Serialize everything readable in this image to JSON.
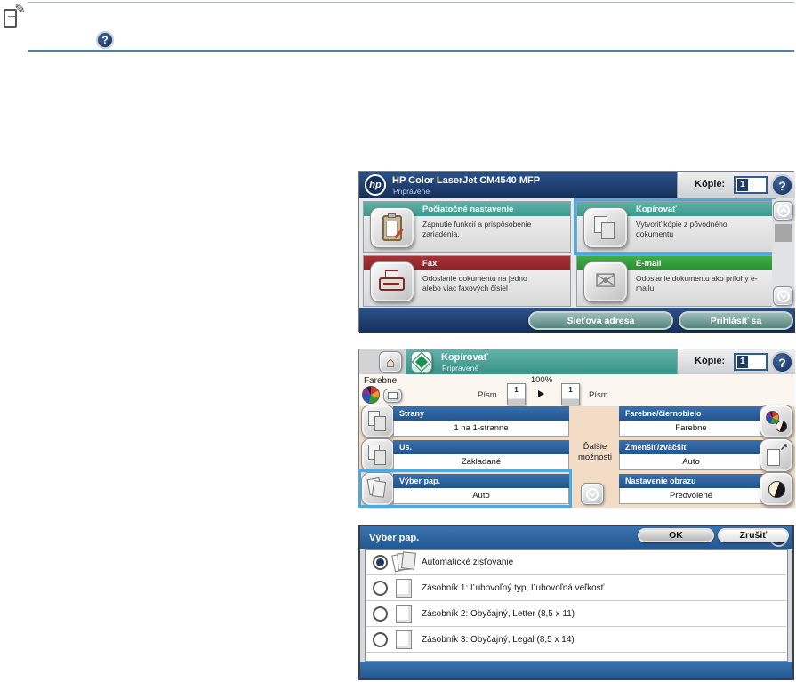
{
  "glyphs": {
    "question": "?",
    "note_pencil": "✎",
    "home": "⌂",
    "envelope": "✉",
    "scale_arrow": "↗"
  },
  "home_screen": {
    "logo_text": "hp",
    "title": "HP Color LaserJet CM4540 MFP",
    "status": "Pripravené",
    "copies_label": "Kópie:",
    "copies_value": "1",
    "tiles": [
      {
        "label": "Počiatočné nastavenie",
        "desc": "Zapnutie funkcií a prispôsobenie\nzariadenia."
      },
      {
        "label": "Kopírovať",
        "desc": "Vytvoriť kópie z pôvodného\ndokumentu"
      },
      {
        "label": "Fax",
        "desc": "Odoslanie dokumentu na jedno\nalebo viac faxových čísiel"
      },
      {
        "label": "E-mail",
        "desc": "Odoslanie dokumentu ako prílohy e-\nmailu"
      }
    ],
    "footer": {
      "network_address": "Sieťová adresa",
      "sign_in": "Prihlásiť sa"
    }
  },
  "copy_screen": {
    "title": "Kopírovať",
    "status": "Pripravené",
    "copies_label": "Kópie:",
    "copies_value": "1",
    "color_mode_label": "Farebne",
    "zoom_percent": "100%",
    "page_left": {
      "number": "1",
      "size_label": "Písm."
    },
    "page_right": {
      "number": "1",
      "size_label": "Písm."
    },
    "more_options_label": "Ďalšie\nmožnosti",
    "options_left": [
      {
        "label": "Strany",
        "value": "1 na 1-stranne"
      },
      {
        "label": "Us.",
        "value": "Zakladané"
      },
      {
        "label": "Výber pap.",
        "value": "Auto"
      }
    ],
    "options_right": [
      {
        "label": "Farebne/čiernobielo",
        "value": "Farebne"
      },
      {
        "label": "Zmenšiť/zväčšiť",
        "value": "Auto"
      },
      {
        "label": "Nastavenie obrazu",
        "value": "Predvolené"
      }
    ]
  },
  "paper_dialog": {
    "title": "Výber pap.",
    "options": [
      {
        "label": "Automatické zisťovanie",
        "selected": true
      },
      {
        "label": "Zásobník 1: Ľubovoľný typ, Ľubovoľná veľkosť",
        "selected": false
      },
      {
        "label": "Zásobník 2: Obyčajný, Letter (8,5 x 11)",
        "selected": false
      },
      {
        "label": "Zásobník 3: Obyčajný, Legal (8,5 x 14)",
        "selected": false
      }
    ],
    "ok_label": "OK",
    "cancel_label": "Zrušiť"
  },
  "colors": {
    "navy": "#1d3b66",
    "teal": "#44a096",
    "fax_red": "#94262c",
    "email_green": "#2f9a38",
    "option_blue": "#2b5f9b",
    "dialog_blue": "#2b6199",
    "peach": "#f3dcc6",
    "selection_blue": "#4fa8e0"
  }
}
